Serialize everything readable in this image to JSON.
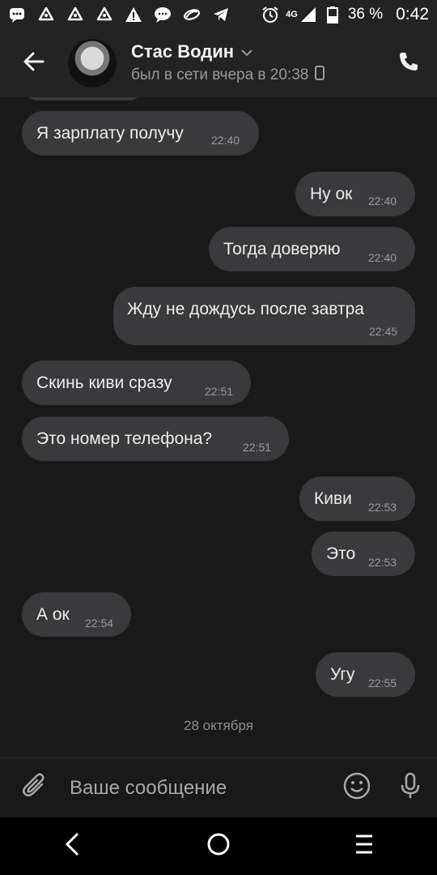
{
  "status_bar": {
    "battery_percent": "36 %",
    "time": "0:42",
    "network": "4G",
    "icons_left": [
      "message-icon",
      "sync-icon",
      "sync-icon",
      "sync-icon",
      "warning-icon",
      "chat-icon",
      "brand-icon",
      "telegram-icon"
    ],
    "icons_right": [
      "alarm-icon",
      "signal-icon",
      "battery-icon"
    ]
  },
  "header": {
    "contact_name": "Стас Водин",
    "last_seen": "был в сети вчера в 20:38"
  },
  "messages": [
    {
      "dir": "in",
      "text": "Я зарплату получу",
      "time": "22:40"
    },
    {
      "dir": "out",
      "text": "Ну ок",
      "time": "22:40"
    },
    {
      "dir": "out",
      "text": "Тогда доверяю",
      "time": "22:40"
    },
    {
      "dir": "out",
      "text": "Жду не дождусь после завтра",
      "time": "22:45"
    },
    {
      "dir": "in",
      "text": "Скинь киви сразу",
      "time": "22:51"
    },
    {
      "dir": "in",
      "text": "Это номер телефона?",
      "time": "22:51"
    },
    {
      "dir": "out",
      "text": "Киви",
      "time": "22:53"
    },
    {
      "dir": "out",
      "text": "Это",
      "time": "22:53"
    },
    {
      "dir": "in",
      "text": "А ок",
      "time": "22:54"
    },
    {
      "dir": "out",
      "text": "Угу",
      "time": "22:55"
    }
  ],
  "date_divider": "28 октября",
  "composer": {
    "placeholder": "Ваше сообщение"
  },
  "colors": {
    "background": "#19191a",
    "bar": "#232324",
    "bubble": "#3a3a3c"
  }
}
